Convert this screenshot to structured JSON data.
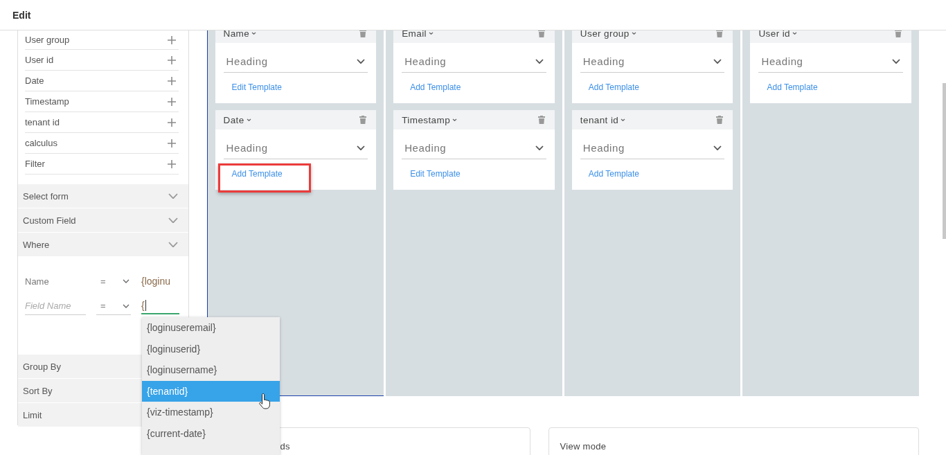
{
  "window": {
    "title": "Edit"
  },
  "fields": [
    {
      "label": "User group"
    },
    {
      "label": "User id"
    },
    {
      "label": "Date"
    },
    {
      "label": "Timestamp"
    },
    {
      "label": "tenant id"
    },
    {
      "label": "calculus"
    },
    {
      "label": "Filter"
    }
  ],
  "sections": [
    {
      "label": "Select form"
    },
    {
      "label": "Custom Field"
    },
    {
      "label": "Where"
    }
  ],
  "where": [
    {
      "field": "Name",
      "operator": "=",
      "value": "{loginu",
      "focused": false
    },
    {
      "placeholder": "Field Name",
      "operator": "=",
      "value": "{",
      "focused": true
    }
  ],
  "lower_sections": [
    {
      "label": "Group By"
    },
    {
      "label": "Sort By"
    },
    {
      "label": "Limit"
    }
  ],
  "suggestions": [
    {
      "label": "{loginuseremail}",
      "selected": false
    },
    {
      "label": "{loginuserid}",
      "selected": false
    },
    {
      "label": "{loginusername}",
      "selected": false
    },
    {
      "label": "{tenantid}",
      "selected": true
    },
    {
      "label": "{viz-timestamp}",
      "selected": false
    },
    {
      "label": "{current-date}",
      "selected": false
    }
  ],
  "columns": [
    {
      "focused": true,
      "cards": [
        {
          "title": "Name",
          "heading": "Heading",
          "link": "Edit Template",
          "highlighted": false
        },
        {
          "title": "Date",
          "heading": "Heading",
          "link": "Add Template",
          "highlighted": true
        }
      ]
    },
    {
      "focused": false,
      "cards": [
        {
          "title": "Email",
          "heading": "Heading",
          "link": "Add Template",
          "highlighted": false
        },
        {
          "title": "Timestamp",
          "heading": "Heading",
          "link": "Edit Template",
          "highlighted": false
        }
      ]
    },
    {
      "focused": false,
      "cards": [
        {
          "title": "User group",
          "heading": "Heading",
          "link": "Add Template",
          "highlighted": false
        },
        {
          "title": "tenant id",
          "heading": "Heading",
          "link": "Add Template",
          "highlighted": false
        }
      ]
    },
    {
      "focused": false,
      "cards": [
        {
          "title": "User id",
          "heading": "Heading",
          "link": "Add Template",
          "highlighted": false
        }
      ]
    }
  ],
  "bottom_cards": [
    {
      "title": "ds"
    },
    {
      "title": "View mode"
    }
  ]
}
